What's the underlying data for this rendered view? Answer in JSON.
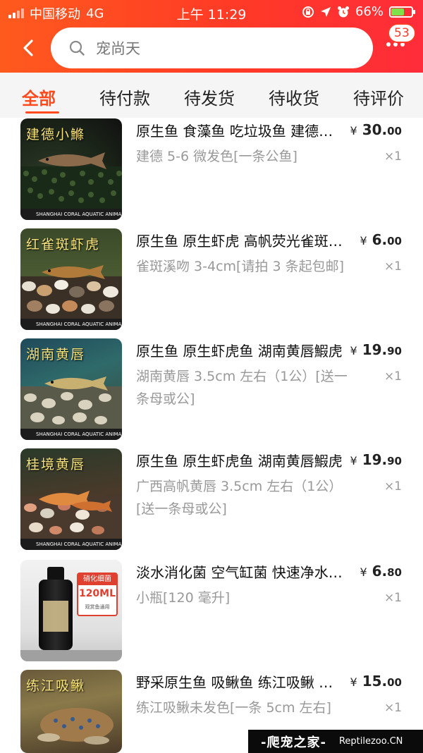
{
  "status_bar": {
    "carrier": "中国移动",
    "network": "4G",
    "time": "上午 11:29",
    "battery_percent": "66%",
    "battery_level": 0.66
  },
  "header": {
    "search_text": "宠尚天",
    "badge_count": "53",
    "icons": {
      "back": "back-arrow-icon",
      "search": "search-icon",
      "more": "more-dots-icon"
    }
  },
  "tabs": [
    {
      "label": "全部",
      "active": true
    },
    {
      "label": "待付款",
      "active": false
    },
    {
      "label": "待发货",
      "active": false
    },
    {
      "label": "待收货",
      "active": false
    },
    {
      "label": "待评价",
      "active": false
    }
  ],
  "items": [
    {
      "title": "原生鱼 食藻鱼 吃垃圾鱼 建德小鰷鱼",
      "spec": "建德 5-6 微发色[一条公鱼]",
      "price_currency": "¥",
      "price_int": "30.",
      "price_dec": "00",
      "qty": "×1",
      "thumb_caption": "建德小鰷",
      "thumb_footer": "SHANGHAI CORAL AQUATIC ANIMAL IMPORT & EXPORT TRADING CO. LTD"
    },
    {
      "title": "原生鱼 原生虾虎  高帆荧光雀斑溪吻",
      "spec": "雀斑溪吻 3-4cm[请拍 3 条起包邮]",
      "price_currency": "¥",
      "price_int": "6.",
      "price_dec": "00",
      "qty": "×1",
      "thumb_caption": "红雀斑虾虎",
      "thumb_footer": "SHANGHAI CORAL AQUATIC ANIMAL IMPORT & EXPORT TRADING CO. LTD"
    },
    {
      "title": "原生鱼 原生虾虎鱼 湖南黄唇鰕虎",
      "spec": "湖南黄唇 3.5cm 左右（1公）[送一条母或公]",
      "price_currency": "¥",
      "price_int": "19.",
      "price_dec": "90",
      "qty": "×1",
      "thumb_caption": "湖南黄唇",
      "thumb_footer": "SHANGHAI CORAL AQUATIC ANIMAL IMPORT & EXPORT TRADING CO. LTD"
    },
    {
      "title": "原生鱼 原生虾虎鱼 湖南黄唇鰕虎",
      "spec": "广西高帆黄唇 3.5cm 左右（1公）[送一条母或公]",
      "price_currency": "¥",
      "price_int": "19.",
      "price_dec": "90",
      "qty": "×1",
      "thumb_caption": "桂境黄唇",
      "thumb_footer": "SHANGHAI CORAL AQUATIC ANIMAL IMPORT & EXPORT TRADING CO. LTD"
    },
    {
      "title": "淡水消化菌 空气缸菌 快速净水硝化细菌",
      "spec": "小瓶[120 毫升]",
      "price_currency": "¥",
      "price_int": "6.",
      "price_dec": "80",
      "qty": "×1",
      "thumb_label_top": "硝化细菌",
      "thumb_label_main": "120ML",
      "thumb_label_sub": "观赏鱼通用"
    },
    {
      "title": "野采原生鱼 吸鳅鱼 练江吸鳅 原生溪流",
      "spec": "练江吸鳅未发色[一条 5cm 左右]",
      "price_currency": "¥",
      "price_int": "15.",
      "price_dec": "00",
      "qty": "×1",
      "thumb_caption": "练江吸鳅"
    }
  ],
  "watermark": {
    "brand": "-爬宠之家-",
    "url": "Reptilezoo.CN"
  },
  "colors": {
    "header_gradient_start": "#ff5a1e",
    "header_gradient_end": "#ff2c3a",
    "accent": "#ff4a1e",
    "tab_bar_bg": "#f5f5f5",
    "muted_text": "#999999"
  }
}
